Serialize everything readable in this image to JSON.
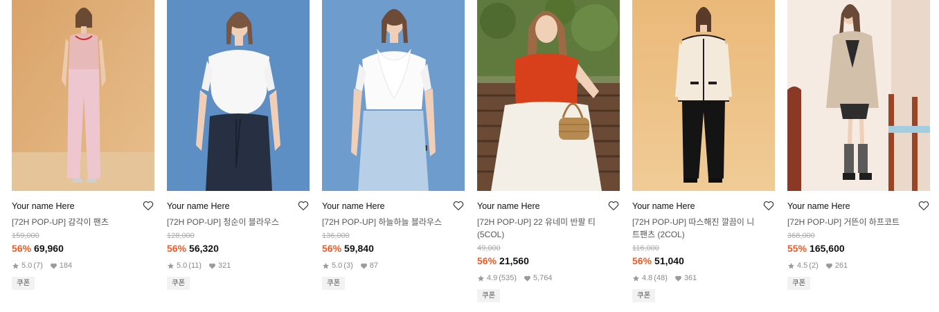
{
  "products": [
    {
      "brand": "Your name Here",
      "title": "[72H POP-UP] 감각이 팬츠",
      "original_price": "159,000",
      "discount": "56%",
      "price": "69,960",
      "rating": "5.0",
      "reviews": "(7)",
      "likes": "184",
      "coupon": "쿠폰",
      "photo": "model-pink-sleeveless-top-pink-pants"
    },
    {
      "brand": "Your name Here",
      "title": "[72H POP-UP] 청순이 블라우스",
      "original_price": "128,000",
      "discount": "56%",
      "price": "56,320",
      "rating": "5.0",
      "reviews": "(11)",
      "likes": "321",
      "coupon": "쿠폰",
      "photo": "model-white-blouse-navy-skirt"
    },
    {
      "brand": "Your name Here",
      "title": "[72H POP-UP] 하늘하늘 블라우스",
      "original_price": "136,000",
      "discount": "56%",
      "price": "59,840",
      "rating": "5.0",
      "reviews": "(3)",
      "likes": "87",
      "coupon": "쿠폰",
      "photo": "model-ruffle-blouse-blue-skirt"
    },
    {
      "brand": "Your name Here",
      "title": "[72H POP-UP] 22 유네미 반팔 티 (5COL)",
      "original_price": "49,000",
      "discount": "56%",
      "price": "21,560",
      "rating": "4.9",
      "reviews": "(535)",
      "likes": "5,764",
      "coupon": "쿠폰",
      "photo": "model-orange-tee-white-skirt-basket-bag"
    },
    {
      "brand": "Your name Here",
      "title": "[72H POP-UP] 따스해진 깔끔이 니트팬츠 (2COL)",
      "original_price": "116,000",
      "discount": "56%",
      "price": "51,040",
      "rating": "4.8",
      "reviews": "(48)",
      "likes": "361",
      "coupon": "쿠폰",
      "photo": "model-cream-cardigan-black-pants"
    },
    {
      "brand": "Your name Here",
      "title": "[72H POP-UP] 거뜬이 하프코트",
      "original_price": "368,000",
      "discount": "55%",
      "price": "165,600",
      "rating": "4.5",
      "reviews": "(2)",
      "likes": "261",
      "coupon": "쿠폰",
      "photo": "model-beige-coat-chair"
    }
  ],
  "colors": {
    "discount": "#f15a24",
    "price": "#111111",
    "muted": "#8a8a8a",
    "coupon_bg": "#f2f2f2"
  }
}
